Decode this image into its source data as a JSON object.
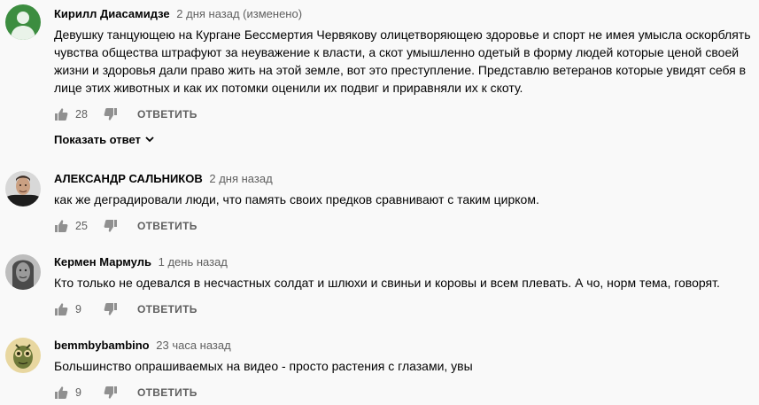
{
  "comments": [
    {
      "author": "Кирилл Диасамидзе",
      "time": "2 дня назад (изменено)",
      "text": "Девушку танцующею на Кургане Бессмертия Червякову олицетворяющею здоровье и спорт не имея умысла оскорблять чувства общества штрафуют за неуважение к власти,  а скот умышленно одетый в форму людей которые ценой своей жизни и здоровья  дали право жить на этой земле, вот это преступление. Представлю ветеранов которые увидят себя в лице этих животных и как их потомки оценили их подвиг и приравняли их к скоту.",
      "likes": "28",
      "reply_label": "ОТВЕТИТЬ",
      "avatar_color": "#3c8d40"
    },
    {
      "author": "АЛЕКСАНДР САЛЬНИКОВ",
      "time": "2 дня назад",
      "text": "как же деградировали люди, что память своих предков сравнивают с таким цирком.",
      "likes": "25",
      "reply_label": "ОТВЕТИТЬ"
    },
    {
      "author": "Кермен Мармуль",
      "time": "1 день назад",
      "text": "Кто только не одевался в несчастных солдат и шлюхи и свиньи и коровы и всем плевать. А чо, норм тема, говорят.",
      "likes": "9",
      "reply_label": "ОТВЕТИТЬ"
    },
    {
      "author": "bemmbybambino",
      "time": "23 часа назад",
      "text": "Большинство опрашиваемых на видео - просто растения с глазами, увы",
      "likes": "9",
      "reply_label": "ОТВЕТИТЬ"
    }
  ],
  "show_replies_label": "Показать ответ",
  "colors": {
    "background": "#f9f9f9",
    "text": "#030303",
    "secondary": "#606060"
  }
}
